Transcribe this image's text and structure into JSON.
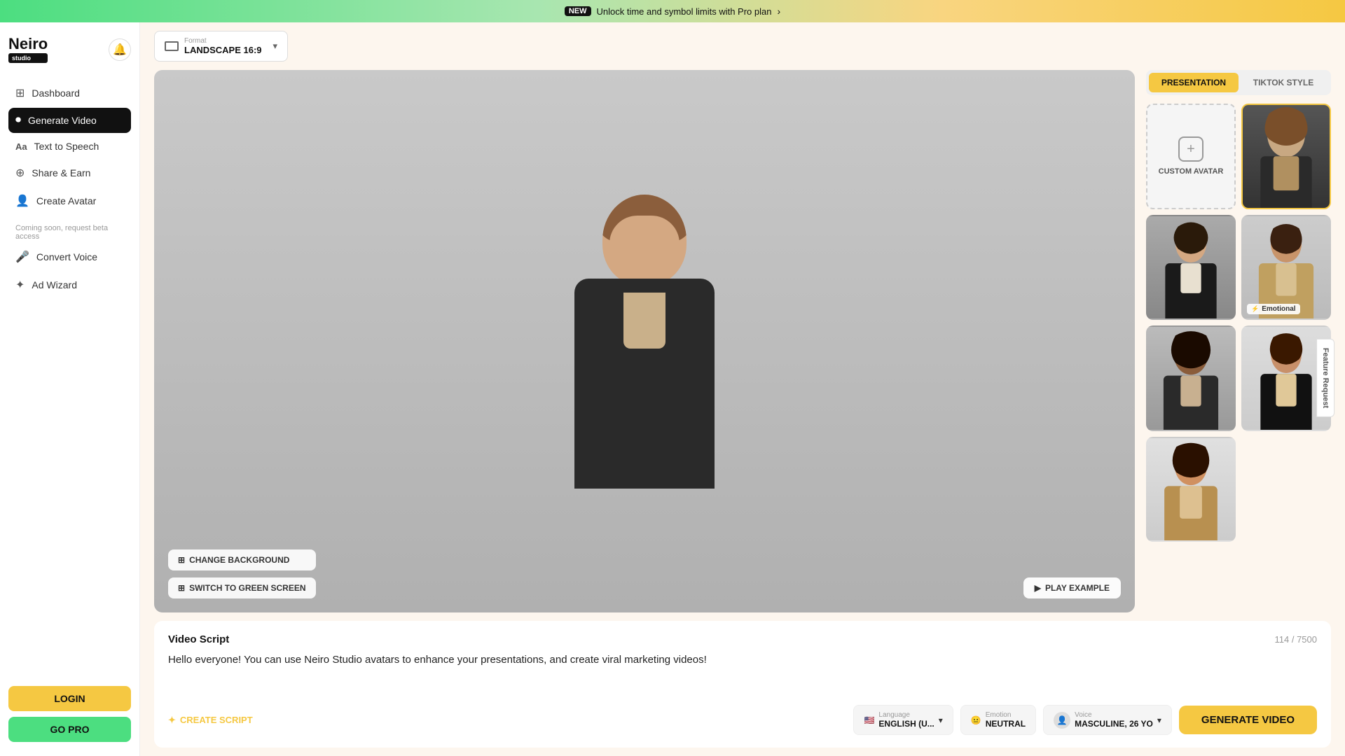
{
  "banner": {
    "badge": "NEW",
    "text": "Unlock time and symbol limits with Pro plan",
    "arrow": "›"
  },
  "sidebar": {
    "logo": "Neiro",
    "logo_badge": "studio",
    "nav_items": [
      {
        "id": "dashboard",
        "label": "Dashboard",
        "icon": "⊞",
        "active": false
      },
      {
        "id": "generate-video",
        "label": "Generate Video",
        "icon": "⏺",
        "active": true
      },
      {
        "id": "text-to-speech",
        "label": "Text to Speech",
        "icon": "Aa",
        "active": false
      },
      {
        "id": "share-earn",
        "label": "Share & Earn",
        "icon": "⊕",
        "active": false
      },
      {
        "id": "create-avatar",
        "label": "Create Avatar",
        "icon": "👤",
        "active": false
      }
    ],
    "coming_soon_text": "Coming soon, request beta access",
    "beta_items": [
      {
        "id": "convert-voice",
        "label": "Convert Voice",
        "icon": "🎤"
      },
      {
        "id": "ad-wizard",
        "label": "Ad Wizard",
        "icon": "✦"
      }
    ],
    "login_label": "LOGIN",
    "gopro_label": "GO PRO"
  },
  "toolbar": {
    "format_label": "Format",
    "format_value": "LANDSCAPE 16:9",
    "dropdown_arrow": "▾"
  },
  "avatar_panel": {
    "tabs": [
      {
        "id": "presentation",
        "label": "PRESENTATION",
        "active": true
      },
      {
        "id": "tiktok-style",
        "label": "TIKTOK STYLE",
        "active": false
      }
    ],
    "custom_avatar_label": "CUSTOM AVATAR",
    "emotional_badge": "Emotional",
    "avatars": [
      {
        "id": "custom",
        "type": "custom"
      },
      {
        "id": "av1",
        "type": "selected",
        "bg": "av-bg-1"
      },
      {
        "id": "av2",
        "type": "normal",
        "bg": "av-bg-2"
      },
      {
        "id": "av3",
        "type": "emotional",
        "bg": "av-bg-3"
      },
      {
        "id": "av4",
        "type": "normal",
        "bg": "av-bg-4"
      },
      {
        "id": "av5",
        "type": "normal",
        "bg": "av-bg-5"
      },
      {
        "id": "av6",
        "type": "normal",
        "bg": "av-bg-6"
      },
      {
        "id": "av7",
        "type": "normal",
        "bg": "av-bg-7"
      },
      {
        "id": "av8",
        "type": "normal",
        "bg": "av-bg-8"
      }
    ]
  },
  "video_preview": {
    "change_background_label": "CHANGE BACKGROUND",
    "switch_green_screen_label": "SWITCH TO GREEN SCREEN",
    "play_example_label": "PLAY EXAMPLE"
  },
  "script": {
    "title": "Video Script",
    "counter": "114 / 7500",
    "content": "Hello everyone! You can use Neiro Studio avatars to enhance your presentations, and create viral marketing videos!",
    "create_script_label": "CREATE SCRIPT",
    "create_script_icon": "✦"
  },
  "script_options": {
    "language": {
      "label": "Language",
      "value": "ENGLISH (U...",
      "flag": "🇺🇸"
    },
    "emotion": {
      "label": "Emotion",
      "value": "NEUTRAL",
      "icon": "😐"
    },
    "voice": {
      "label": "Voice",
      "value": "MASCULINE, 26 YO",
      "has_dropdown": true
    },
    "generate_label": "GENERATE VIDEO"
  },
  "feature_request": {
    "label": "Feature Request"
  }
}
